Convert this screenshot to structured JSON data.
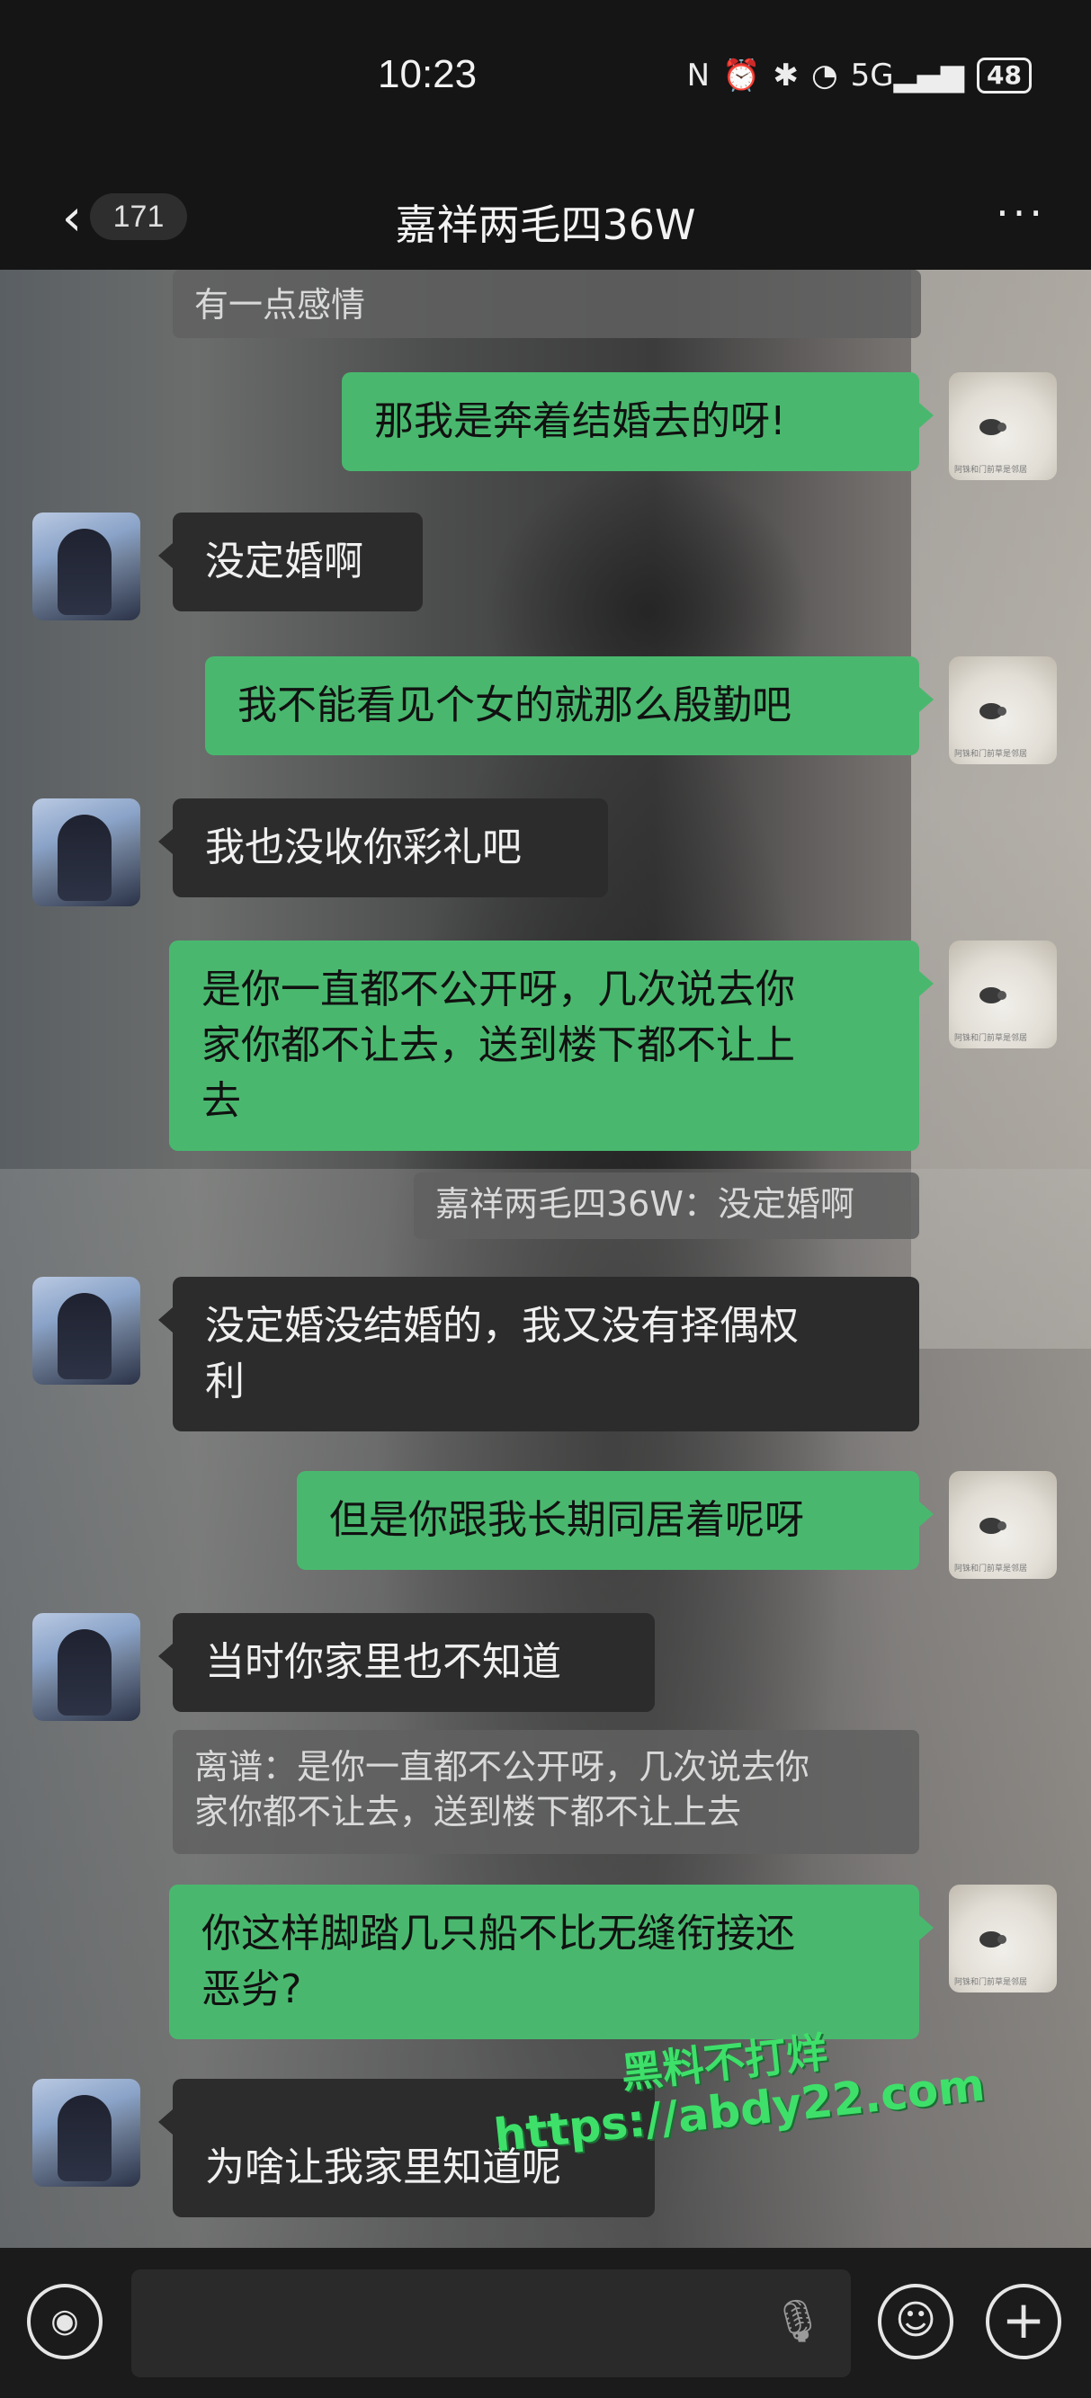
{
  "status_bar": {
    "time": "10:23",
    "icons": [
      "nfc-icon",
      "alarm-icon",
      "bluetooth-icon",
      "wifi-icon",
      "signal-5g-icon"
    ],
    "nfc": "N",
    "alarm": "⏰",
    "bluetooth": "✱",
    "wifi": "◔",
    "signal": "5G▂▄▆",
    "battery": "48"
  },
  "header": {
    "back": "‹",
    "unread_count": "171",
    "title": "嘉祥两毛四36W",
    "more": "···"
  },
  "messages": [
    {
      "side": "quote",
      "text": "有一点感情"
    },
    {
      "side": "right",
      "text": "那我是奔着结婚去的呀!"
    },
    {
      "side": "left",
      "text": "没定婚啊"
    },
    {
      "side": "right",
      "text": "我不能看见个女的就那么殷勤吧"
    },
    {
      "side": "left",
      "text": "我也没收你彩礼吧"
    },
    {
      "side": "right",
      "lines": [
        "是你一直都不公开呀，几次说去你",
        "家你都不让去，送到楼下都不让上",
        "去"
      ]
    },
    {
      "side": "quote",
      "text": "嘉祥两毛四36W：没定婚啊"
    },
    {
      "side": "left",
      "lines": [
        "没定婚没结婚的，我又没有择偶权",
        "利"
      ]
    },
    {
      "side": "right",
      "text": "但是你跟我长期同居着呢呀"
    },
    {
      "side": "left",
      "text": "当时你家里也不知道"
    },
    {
      "side": "quote",
      "lines": [
        "离谱：是你一直都不公开呀，几次说去你",
        "家你都不让去，送到楼下都不让上去"
      ]
    },
    {
      "side": "right",
      "lines": [
        "你这样脚踏几只船不比无缝衔接还",
        "恶劣?"
      ]
    },
    {
      "side": "left",
      "text": "为啥让我家里知道呢"
    }
  ],
  "avatar_caption": "阿铢和门前草是邻居",
  "watermark": {
    "line1": "黑料不打烊",
    "line2": "https://abdy22.com"
  },
  "input_bar": {
    "voice": "◉",
    "mic": "🎙",
    "emoji": "☺",
    "plus": "+"
  }
}
